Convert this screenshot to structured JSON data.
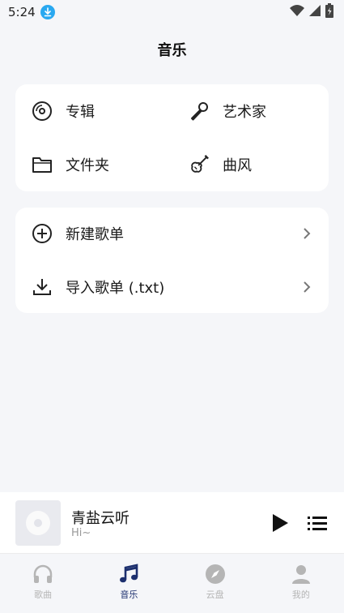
{
  "status_bar": {
    "time": "5:24"
  },
  "header": {
    "title": "音乐"
  },
  "categories": [
    {
      "label": "专辑",
      "icon": "album-icon"
    },
    {
      "label": "艺术家",
      "icon": "microphone-icon"
    },
    {
      "label": "文件夹",
      "icon": "folder-icon"
    },
    {
      "label": "曲风",
      "icon": "guitar-icon"
    }
  ],
  "actions": [
    {
      "label": "新建歌单",
      "icon": "add-circle-icon"
    },
    {
      "label": "导入歌单 (.txt)",
      "icon": "download-icon"
    }
  ],
  "player": {
    "title": "青盐云听",
    "subtitle": "Hi~"
  },
  "tabs": [
    {
      "label": "歌曲",
      "icon": "headphones-icon",
      "active": false
    },
    {
      "label": "音乐",
      "icon": "music-note-icon",
      "active": true
    },
    {
      "label": "云盘",
      "icon": "compass-icon",
      "active": false
    },
    {
      "label": "我的",
      "icon": "person-icon",
      "active": false
    }
  ],
  "colors": {
    "accent": "#1c2f6e",
    "inactive": "#b5b5b5",
    "download_badge": "#29a8f0"
  }
}
